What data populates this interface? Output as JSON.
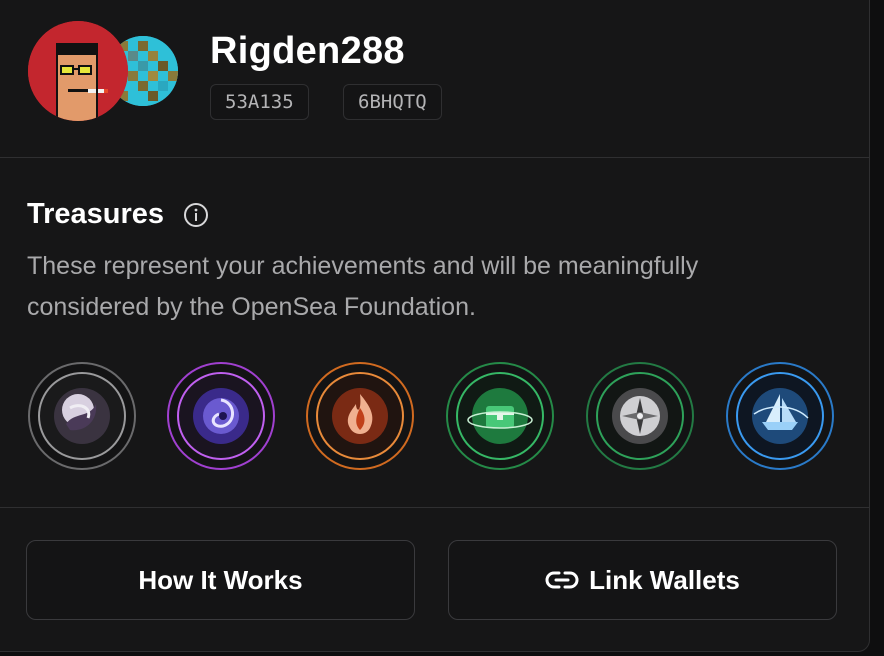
{
  "profile": {
    "username": "Rigden288",
    "tags": [
      "53A135",
      "6BHQTQ"
    ]
  },
  "treasures": {
    "title": "Treasures",
    "info_icon": "info-circle-icon",
    "description": "These represent your achievements and will be meaningfully considered by the OpenSea Foundation."
  },
  "badges": [
    {
      "icon": "silver-swirl-orb-icon",
      "ring_color": "#8a8a8c"
    },
    {
      "icon": "purple-vortex-orb-icon",
      "ring_color": "#b04de0"
    },
    {
      "icon": "flame-orb-icon",
      "ring_color": "#e0762a"
    },
    {
      "icon": "treasure-chest-orb-icon",
      "ring_color": "#2fa85a"
    },
    {
      "icon": "compass-orb-icon",
      "ring_color": "#2e9a55"
    },
    {
      "icon": "ship-orb-icon",
      "ring_color": "#2f8fe0"
    }
  ],
  "buttons": {
    "how_it_works": "How It Works",
    "link_wallets": "Link Wallets"
  }
}
